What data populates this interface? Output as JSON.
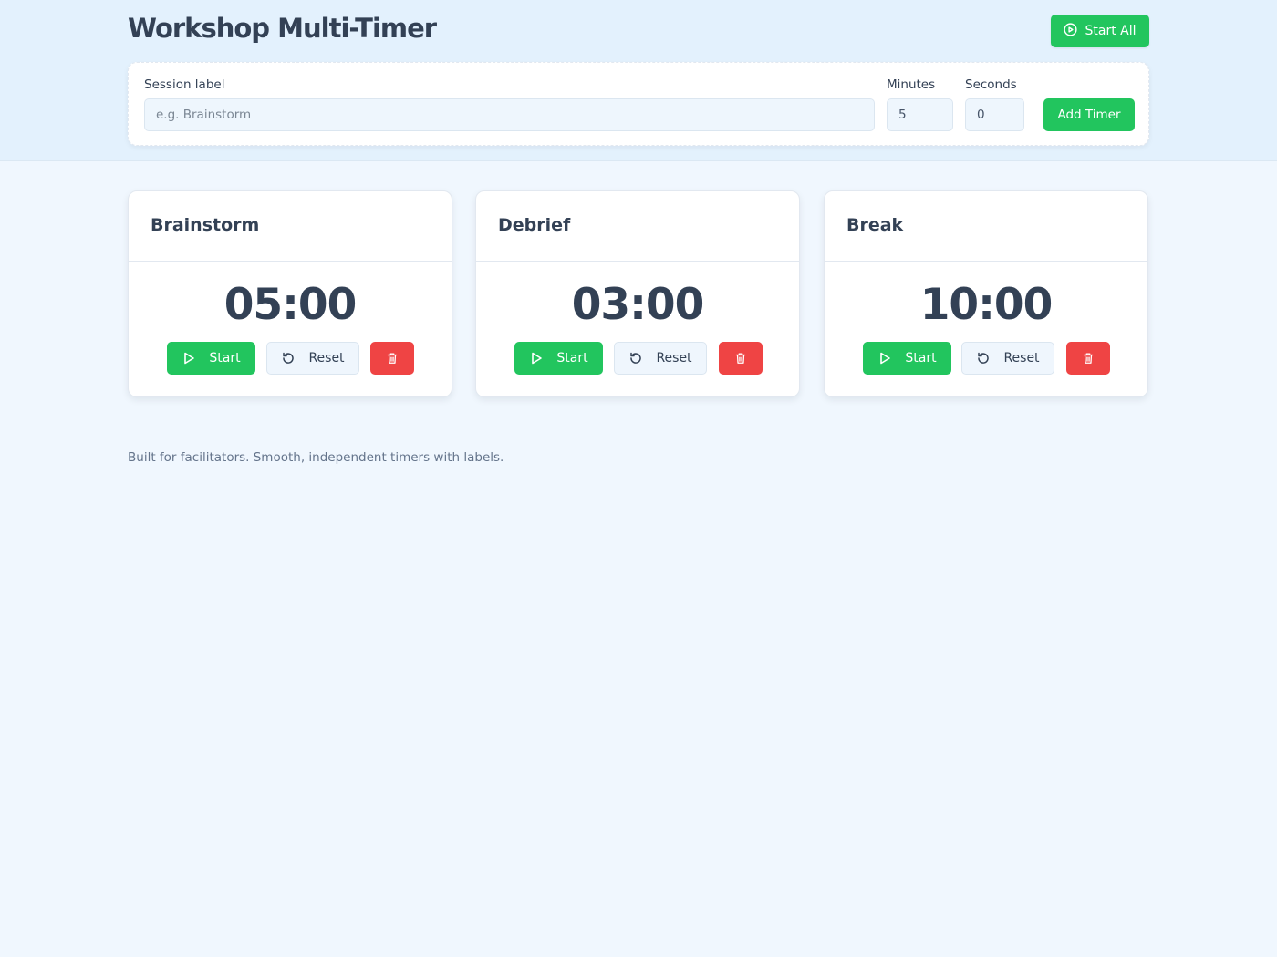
{
  "header": {
    "title": "Workshop Multi-Timer",
    "start_all_label": "Start All",
    "start_all_icon": "play-circle-icon"
  },
  "form": {
    "label_label": "Session label",
    "label_placeholder": "e.g. Brainstorm",
    "label_value": "",
    "minutes_label": "Minutes",
    "minutes_value": "5",
    "seconds_label": "Seconds",
    "seconds_value": "0",
    "add_label": "Add Timer"
  },
  "timers": [
    {
      "title": "Brainstorm",
      "time": "05:00",
      "start_label": "Start",
      "reset_label": "Reset"
    },
    {
      "title": "Debrief",
      "time": "03:00",
      "start_label": "Start",
      "reset_label": "Reset"
    },
    {
      "title": "Break",
      "time": "10:00",
      "start_label": "Start",
      "reset_label": "Reset"
    }
  ],
  "footer": {
    "text": "Built for facilitators. Smooth, independent timers with labels."
  },
  "colors": {
    "accent_green": "#22c55e",
    "danger_red": "#ef4444",
    "text_dark": "#334155",
    "page_bg": "#f0f7fe",
    "header_bg": "#e3f1fd"
  }
}
